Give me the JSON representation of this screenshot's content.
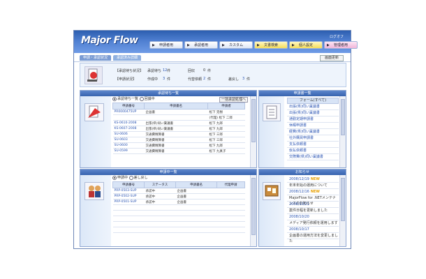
{
  "header": {
    "logo": "Major Flow",
    "logout": "ログオフ",
    "nav": [
      "申請者用",
      "承認者用",
      "カスタム",
      "文書検索",
      "個人設定",
      "管理者用"
    ]
  },
  "tabs": [
    "申請・承認状況",
    "承認済み詳細"
  ],
  "refresh_label": "画面更新",
  "status": {
    "row1": {
      "label": "【承認待ち状況】",
      "pending_label": "承認待ち",
      "pending_value": "12",
      "unit": "件",
      "reject_label": "回収",
      "reject_value": "0",
      "reject_unit": "件"
    },
    "row2": {
      "label": "【申請状況】",
      "making_label": "作成中",
      "making_value": "3",
      "unit": "件",
      "proxy_label": "代替依頼",
      "proxy_value": "2",
      "proxy_unit": "件",
      "back_label": "差戻し",
      "back_value": "3",
      "back_unit": "件"
    }
  },
  "approval_panel": {
    "title": "承認待ち一覧",
    "radio1": "承認待ち一覧",
    "radio2": "回議中",
    "bulk_btn": "一括承認処理へ",
    "columns": [
      "申請番号",
      "申請書名",
      "申請者"
    ],
    "rows": [
      [
        "PR0000475UP",
        "企画書",
        "松下 克樹"
      ],
      [
        "",
        "",
        "(代理) 松下 二郎"
      ],
      [
        "KS-0610-2008",
        "出張(県)伺い稟議書",
        "松下 九郎"
      ],
      [
        "KS-0607-2008",
        "出張(県)伺い稟議書",
        "松下 九郎"
      ],
      [
        "SU-0606",
        "交通費精算書",
        "松下 三郎"
      ],
      [
        "SU-0603",
        "交通費精算書",
        "松下 三郎"
      ],
      [
        "SU-0600",
        "交通費精算書",
        "松下 九郎"
      ],
      [
        "SU-0599",
        "交通費精算書",
        "松下 九真子"
      ]
    ]
  },
  "apply_list": {
    "title": "申請書一覧",
    "header": "フォーム(すべて)",
    "items": [
      "出張(県)伺い稟議書",
      "出張(県)伺い稟議書",
      "通勤定期申請書",
      "休暇申請書",
      "経費(県)伺い稟議書",
      "社外購買申請書",
      "支払依頼書",
      "仮払依頼書",
      "交際費(県)伺い稟議書"
    ]
  },
  "applying_panel": {
    "title": "申請中一覧",
    "radio1": "申請中",
    "radio2": "差し戻し",
    "columns": [
      "申請番号",
      "ステータス",
      "申請書名",
      "代理申請"
    ],
    "rows": [
      [
        "PRP-0503-SUP",
        "承認中",
        "企画書",
        ""
      ],
      [
        "PRP-0502-SUP",
        "承認中",
        "企画書",
        ""
      ],
      [
        "PRP-0501-SUP",
        "承認中",
        "企画書",
        ""
      ]
    ]
  },
  "news": {
    "title": "お知らせ",
    "items": [
      {
        "date": "2008/12/19",
        "new": "NEW",
        "text": "年末年始の運用について"
      },
      {
        "date": "2008/12/16",
        "new": "NEW",
        "text": "MajorFlow for .NETメンテナンスのお知らせ"
      },
      {
        "date": "2008/10/21",
        "new": "",
        "text": "案件日程を更新しました"
      },
      {
        "date": "2008/10/20",
        "new": "",
        "text": "メディア発行依頼を運用します"
      },
      {
        "date": "2008/10/17",
        "new": "",
        "text": "企画書の運用方法を変更しました"
      }
    ]
  },
  "colors": {
    "header": "#3a6bbf",
    "accent": "#2b55b3"
  }
}
